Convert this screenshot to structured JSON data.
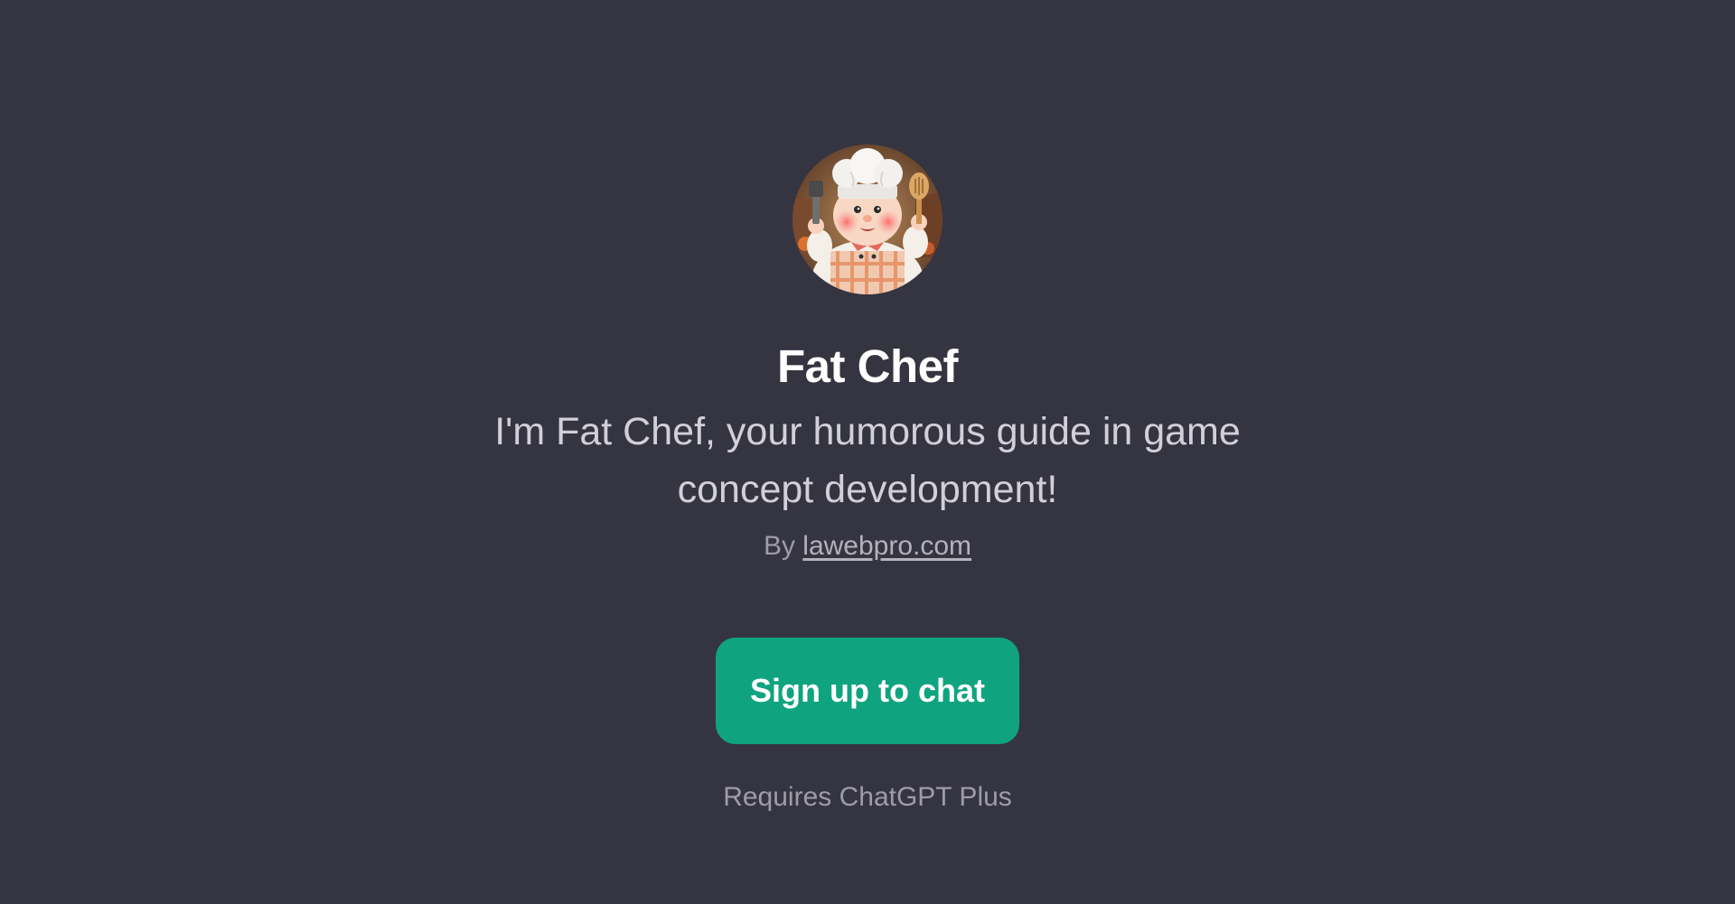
{
  "gpt": {
    "avatar_icon": "fat-chef-avatar",
    "name": "Fat Chef",
    "description": "I'm Fat Chef, your humorous guide in game concept development!",
    "by_prefix": "By",
    "author_link": "lawebpro.com"
  },
  "actions": {
    "signup_label": "Sign up to chat",
    "requirement_note": "Requires ChatGPT Plus"
  },
  "colors": {
    "background": "#353441",
    "accent": "#10a37f",
    "title": "#ffffff",
    "body_text": "#d1d0d9",
    "muted_text": "#9d9ca7"
  }
}
